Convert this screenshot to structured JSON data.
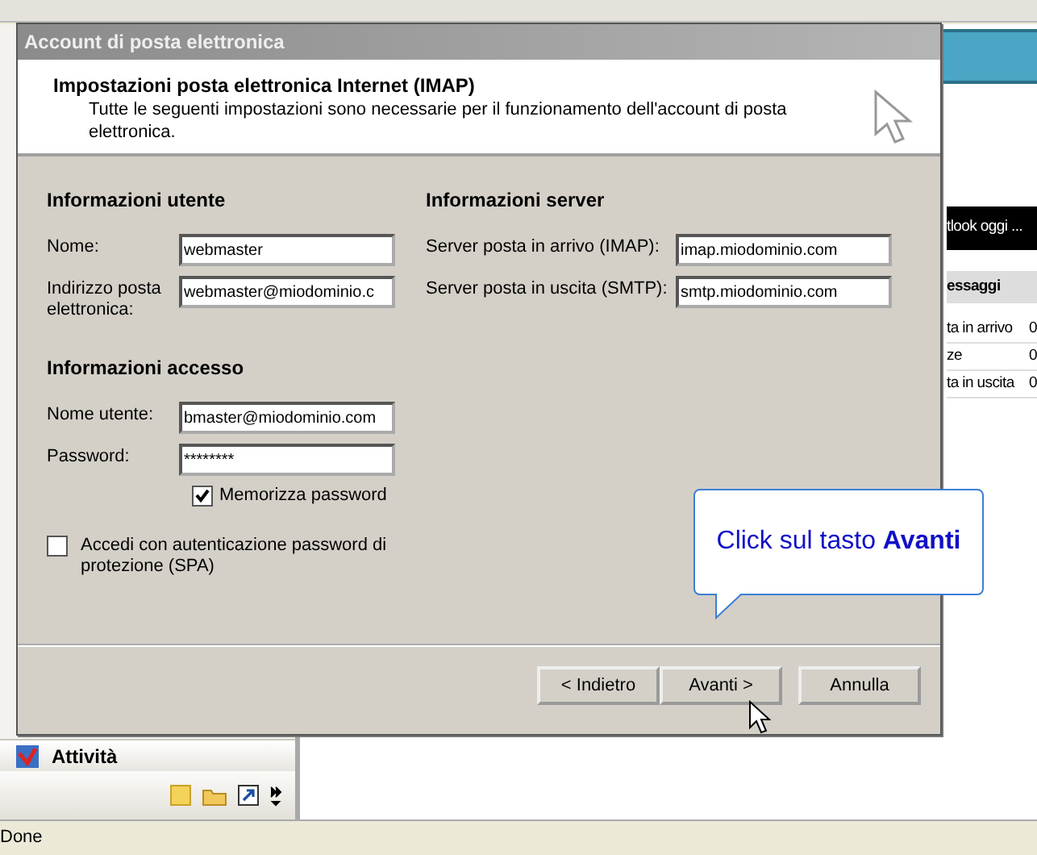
{
  "background": {
    "banner": "tlook oggi ...",
    "messages_header": "essaggi",
    "folders": [
      {
        "name": "ta in arrivo",
        "count": "0"
      },
      {
        "name": "ze",
        "count": "0"
      },
      {
        "name": "ta in uscita",
        "count": "0"
      }
    ],
    "nav_item": "Attività"
  },
  "dialog": {
    "title": "Account di posta elettronica",
    "heading": "Impostazioni posta elettronica Internet (IMAP)",
    "description": "Tutte le seguenti impostazioni sono necessarie per il funzionamento dell'account di posta elettronica.",
    "sections": [
      {
        "title": "Informazioni utente",
        "fields": [
          {
            "label": "Nome:",
            "value": "webmaster"
          },
          {
            "label": "Indirizzo posta elettronica:",
            "value": "webmaster@miodominio.c"
          }
        ]
      },
      {
        "title": "Informazioni server",
        "fields": [
          {
            "label": "Server posta in arrivo (IMAP):",
            "value": "imap.miodominio.com"
          },
          {
            "label": "Server posta in uscita (SMTP):",
            "value": "smtp.miodominio.com"
          }
        ]
      },
      {
        "title": "Informazioni accesso",
        "fields": [
          {
            "label": "Nome utente:",
            "value": "bmaster@miodominio.com"
          },
          {
            "label": "Password:",
            "value": "********"
          }
        ]
      }
    ],
    "remember_password": {
      "label": "Memorizza password",
      "checked": true
    },
    "spa": {
      "label": "Accedi con autenticazione password di protezione (SPA)",
      "checked": false
    },
    "buttons": [
      {
        "label": "< Indietro"
      },
      {
        "label": "Avanti >"
      },
      {
        "label": "Annulla"
      }
    ]
  },
  "callout": {
    "text": "Click sul tasto **Avanti**"
  },
  "status_bar": "Done"
}
